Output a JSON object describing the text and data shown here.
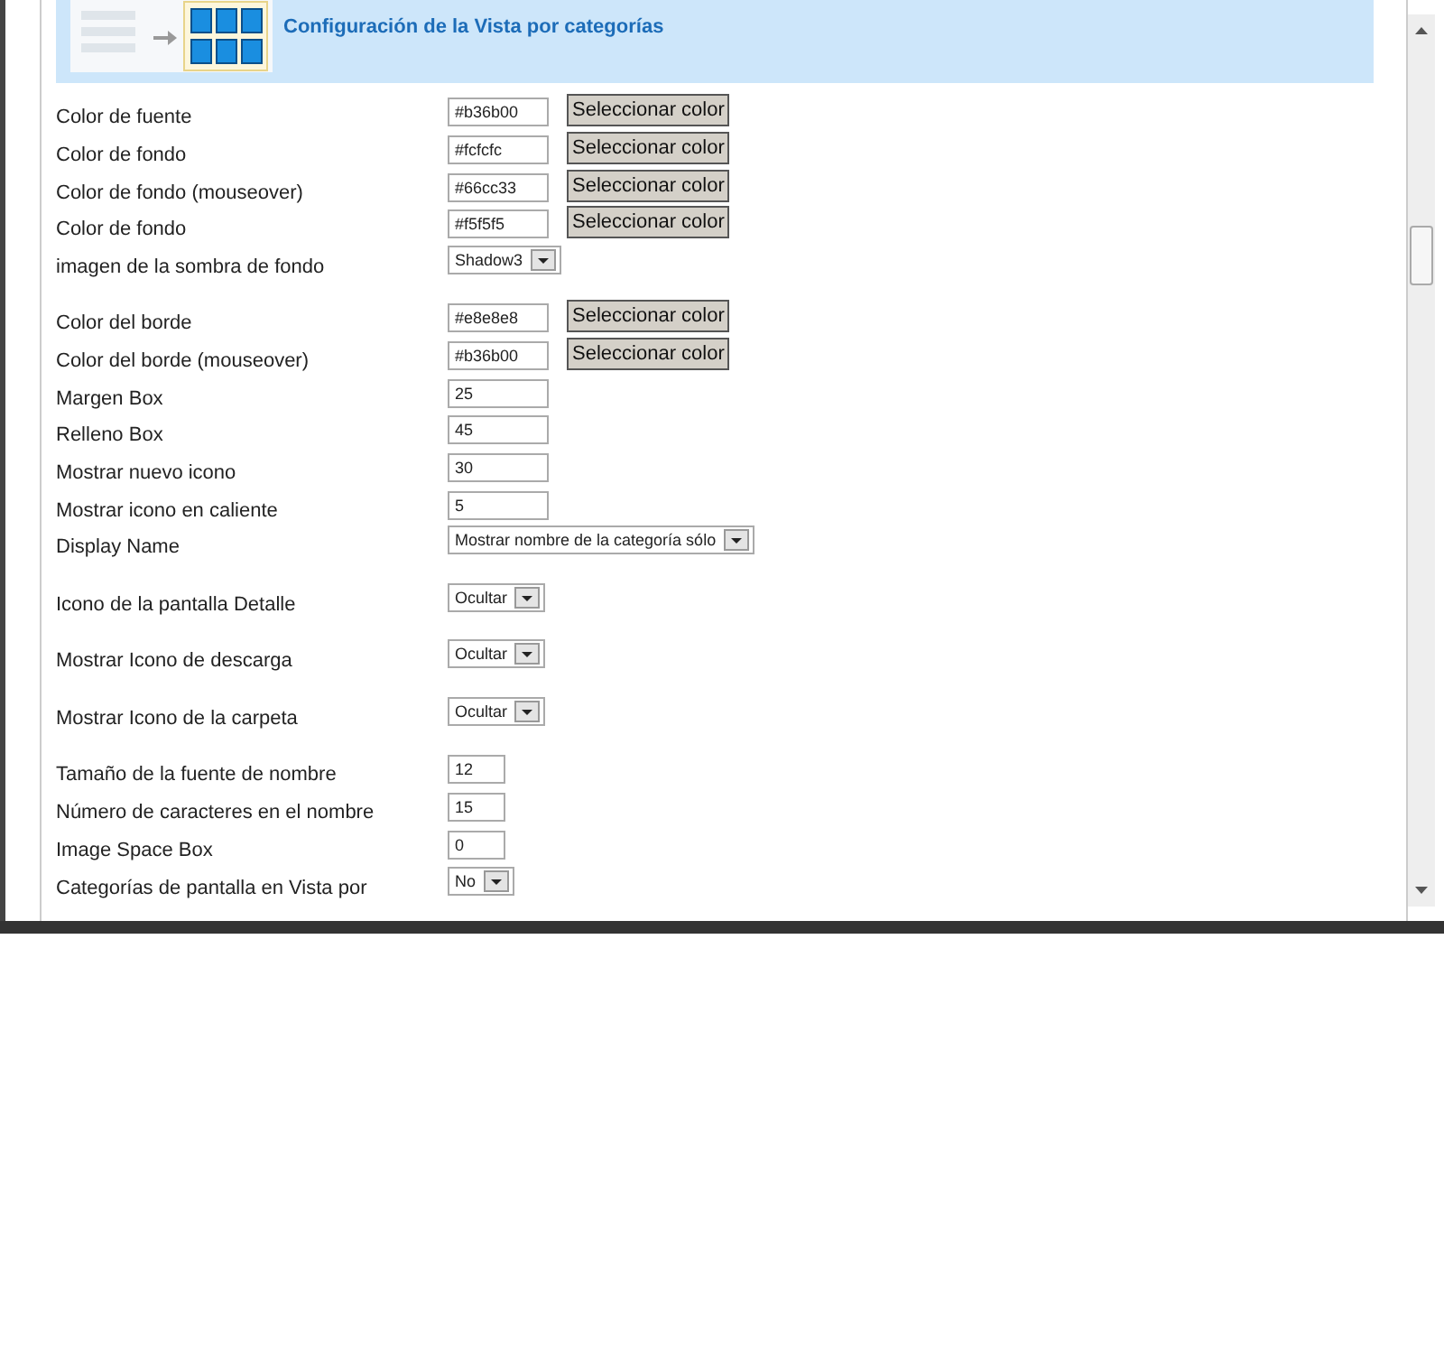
{
  "header": {
    "title": "Configuración de la Vista por categorías"
  },
  "fields": [
    {
      "kind": "color",
      "label": "Color de fuente",
      "value": "#b36b00",
      "button": "Seleccionar color"
    },
    {
      "kind": "color",
      "label": "Color de fondo",
      "value": "#fcfcfc",
      "button": "Seleccionar color"
    },
    {
      "kind": "color",
      "label": "Color de fondo (mouseover)",
      "value": "#66cc33",
      "button": "Seleccionar color"
    },
    {
      "kind": "color",
      "label": "Color de fondo",
      "value": "#f5f5f5",
      "button": "Seleccionar color"
    },
    {
      "kind": "select",
      "label": "imagen de la sombra de fondo",
      "value": "Shadow3"
    },
    {
      "kind": "color",
      "label": "Color del borde",
      "value": "#e8e8e8",
      "button": "Seleccionar color"
    },
    {
      "kind": "color",
      "label": "Color del borde (mouseover)",
      "value": "#b36b00",
      "button": "Seleccionar color"
    },
    {
      "kind": "text",
      "label": "Margen Box",
      "value": "25"
    },
    {
      "kind": "text",
      "label": "Relleno Box",
      "value": "45"
    },
    {
      "kind": "text",
      "label": "Mostrar nuevo icono",
      "value": "30"
    },
    {
      "kind": "text",
      "label": "Mostrar icono en caliente",
      "value": "5"
    },
    {
      "kind": "select",
      "label": "Display Name",
      "value": "Mostrar nombre de la categoría sólo"
    },
    {
      "kind": "select",
      "label": "Icono de la pantalla Detalle",
      "value": "Ocultar"
    },
    {
      "kind": "select",
      "label": "Mostrar Icono de descarga",
      "value": "Ocultar"
    },
    {
      "kind": "select",
      "label": "Mostrar Icono de la carpeta",
      "value": "Ocultar"
    },
    {
      "kind": "short",
      "label": "Tamaño de la fuente de nombre",
      "value": "12"
    },
    {
      "kind": "short",
      "label": "Número de caracteres en el nombre",
      "value": "15"
    },
    {
      "kind": "short",
      "label": "Image Space Box",
      "value": "0"
    },
    {
      "kind": "select",
      "label": "Categorías de pantalla en Vista por",
      "value": "No"
    }
  ]
}
